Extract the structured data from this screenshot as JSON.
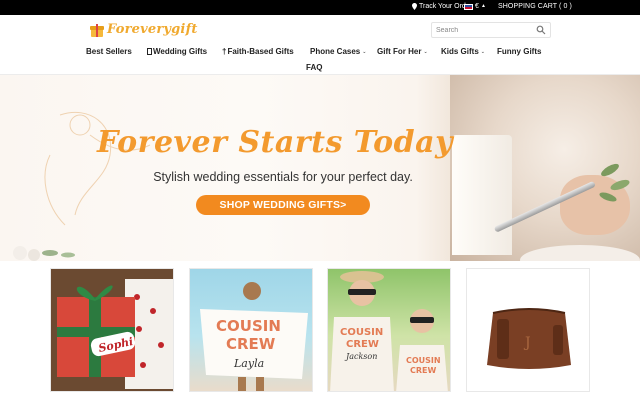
{
  "topbar": {
    "track_label": "Track Your Order",
    "currency": "€",
    "cart_label": "SHOPPING CART ( 0 )"
  },
  "logo": {
    "text": "Foreverygift"
  },
  "search": {
    "placeholder": "Search"
  },
  "nav": {
    "items": [
      {
        "label": "Best Sellers"
      },
      {
        "label": "Wedding Gifts"
      },
      {
        "label": "Faith-Based Gifts"
      },
      {
        "label": "Phone Cases"
      },
      {
        "label": "Gift For Her"
      },
      {
        "label": "Kids Gifts"
      },
      {
        "label": "Funny Gifts"
      },
      {
        "label": "FAQ"
      }
    ]
  },
  "hero": {
    "title": "Forever Starts Today",
    "subtitle": "Stylish wedding essentials for your perfect day.",
    "cta": "SHOP WEDDING GIFTS>"
  },
  "products": {
    "p1_tag": "Sophi",
    "p2_line1": "COUSIN",
    "p2_line2": "CREW",
    "p2_name": "Layla",
    "p3_line1": "COUSIN",
    "p3_line2": "CREW",
    "p3_name": "Jackson"
  },
  "colors": {
    "accent": "#f28a1f",
    "logo": "#f0a92e",
    "title": "#f39a2e"
  }
}
